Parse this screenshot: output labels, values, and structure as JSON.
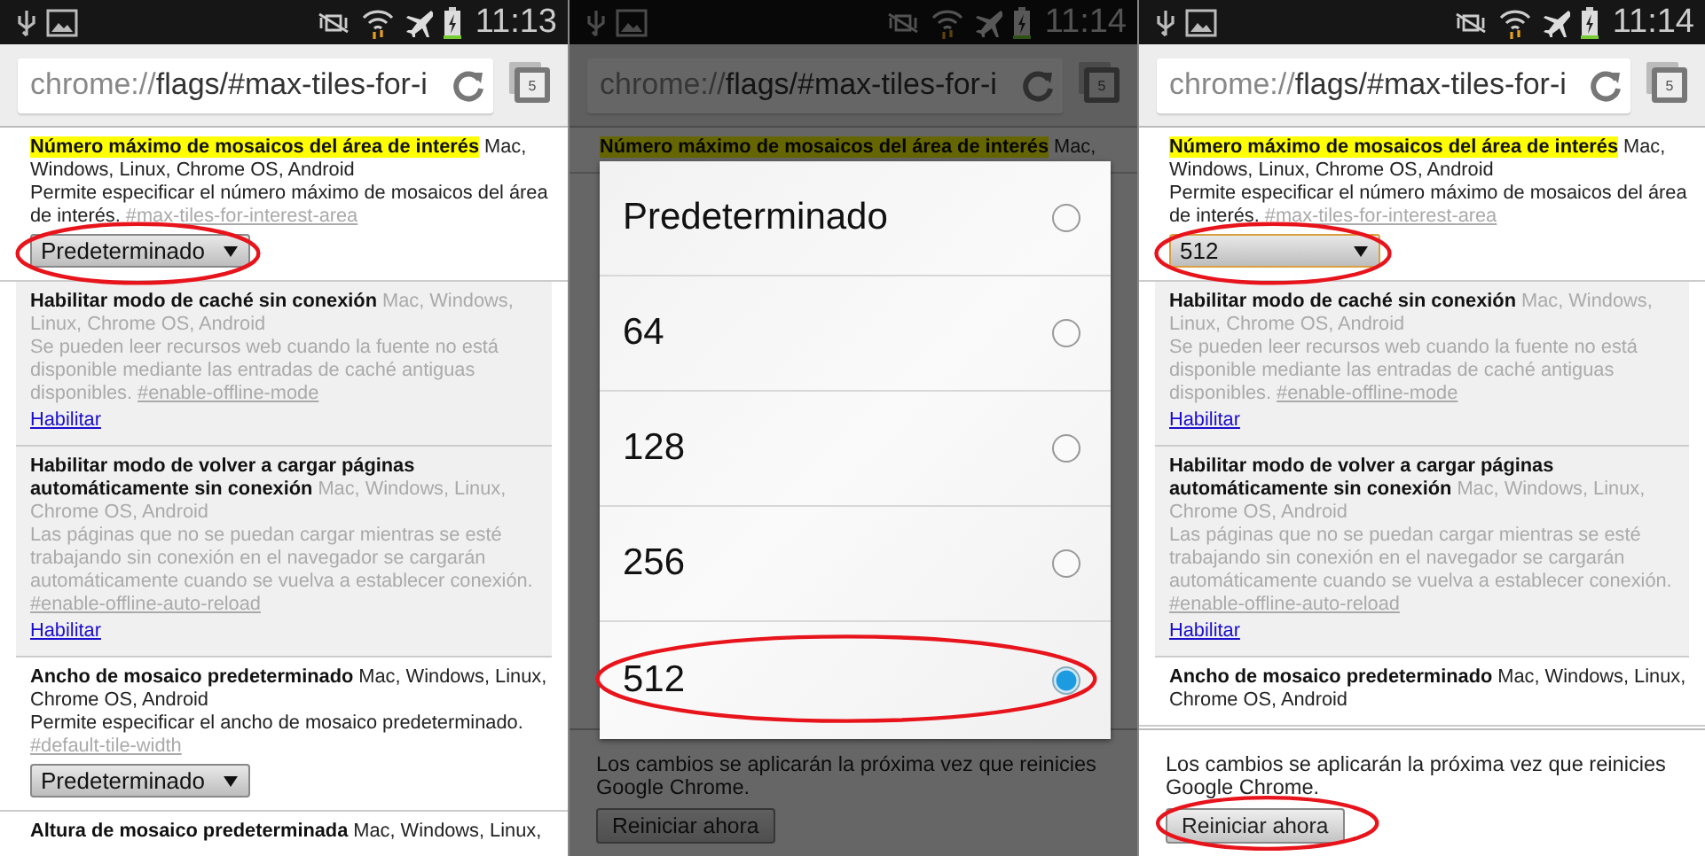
{
  "panels": [
    {
      "status_bar": {
        "time": "11:13"
      },
      "address": {
        "scheme": "chrome://",
        "path": "flags/#max-tiles-for-i"
      },
      "tab_count": "5",
      "experiments": [
        {
          "enabled": true,
          "highlighted": true,
          "title": "Número máximo de mosaicos del área de interés",
          "platforms": "Mac, Windows, Linux, Chrome OS, Android",
          "description": "Permite especificar el número máximo de mosaicos del área de interés.",
          "link": "#max-tiles-for-interest-area",
          "control": {
            "kind": "select",
            "value": "Predeterminado",
            "focused": false,
            "circled": true
          }
        },
        {
          "enabled": false,
          "highlighted": false,
          "title": "Habilitar modo de caché sin conexión",
          "platforms": "Mac, Windows, Linux, Chrome OS, Android",
          "description": "Se pueden leer recursos web cuando la fuente no está disponible mediante las entradas de caché antiguas disponibles.",
          "link": "#enable-offline-mode",
          "control": {
            "kind": "link",
            "value": "Habilitar"
          }
        },
        {
          "enabled": false,
          "highlighted": false,
          "title": "Habilitar modo de volver a cargar páginas automáticamente sin conexión",
          "platforms": "Mac, Windows, Linux, Chrome OS, Android",
          "description": "Las páginas que no se puedan cargar mientras se esté trabajando sin conexión en el navegador se cargarán automáticamente cuando se vuelva a establecer conexión.",
          "link": "#enable-offline-auto-reload",
          "control": {
            "kind": "link",
            "value": "Habilitar"
          }
        },
        {
          "enabled": true,
          "highlighted": false,
          "title": "Ancho de mosaico predeterminado",
          "platforms": "Mac, Windows, Linux, Chrome OS, Android",
          "description": "Permite especificar el ancho de mosaico predeterminado.",
          "link": "#default-tile-width",
          "control": {
            "kind": "select",
            "value": "Predeterminado",
            "focused": false
          }
        },
        {
          "enabled": true,
          "highlighted": false,
          "title": "Altura de mosaico predeterminada",
          "platforms": "Mac, Windows, Linux,"
        }
      ]
    },
    {
      "dimmed": true,
      "status_bar": {
        "time": "11:14"
      },
      "address": {
        "scheme": "chrome://",
        "path": "flags/#max-tiles-for-i"
      },
      "tab_count": "5",
      "experiments": [
        {
          "highlighted": true,
          "title": "Número máximo de mosaicos del área de interés",
          "platforms": "Mac,"
        }
      ],
      "dialog": {
        "options": [
          {
            "label": "Predeterminado",
            "selected": false
          },
          {
            "label": "64",
            "selected": false
          },
          {
            "label": "128",
            "selected": false
          },
          {
            "label": "256",
            "selected": false
          },
          {
            "label": "512",
            "selected": true,
            "circled": true
          }
        ]
      },
      "restart": {
        "message": "Los cambios se aplicarán la próxima vez que reinicies Google Chrome.",
        "button": "Reiniciar ahora"
      }
    },
    {
      "status_bar": {
        "time": "11:14"
      },
      "address": {
        "scheme": "chrome://",
        "path": "flags/#max-tiles-for-i"
      },
      "tab_count": "5",
      "experiments": [
        {
          "enabled": true,
          "highlighted": true,
          "title": "Número máximo de mosaicos del área de interés",
          "platforms": "Mac, Windows, Linux, Chrome OS, Android",
          "description": "Permite especificar el número máximo de mosaicos del área de interés.",
          "link": "#max-tiles-for-interest-area",
          "control": {
            "kind": "select",
            "value": "512",
            "focused": true,
            "circled": true
          }
        },
        {
          "enabled": false,
          "highlighted": false,
          "title": "Habilitar modo de caché sin conexión",
          "platforms": "Mac, Windows, Linux, Chrome OS, Android",
          "description": "Se pueden leer recursos web cuando la fuente no está disponible mediante las entradas de caché antiguas disponibles.",
          "link": "#enable-offline-mode",
          "control": {
            "kind": "link",
            "value": "Habilitar"
          }
        },
        {
          "enabled": false,
          "highlighted": false,
          "title": "Habilitar modo de volver a cargar páginas automáticamente sin conexión",
          "platforms": "Mac, Windows, Linux, Chrome OS, Android",
          "description": "Las páginas que no se puedan cargar mientras se esté trabajando sin conexión en el navegador se cargarán automáticamente cuando se vuelva a establecer conexión.",
          "link": "#enable-offline-auto-reload",
          "control": {
            "kind": "link",
            "value": "Habilitar"
          }
        },
        {
          "enabled": true,
          "highlighted": false,
          "title": "Ancho de mosaico predeterminado",
          "platforms": "Mac, Windows, Linux, Chrome OS, Android"
        }
      ],
      "restart": {
        "message": "Los cambios se aplicarán la próxima vez que reinicies Google Chrome.",
        "button": "Reiniciar ahora",
        "circled": true
      }
    }
  ]
}
